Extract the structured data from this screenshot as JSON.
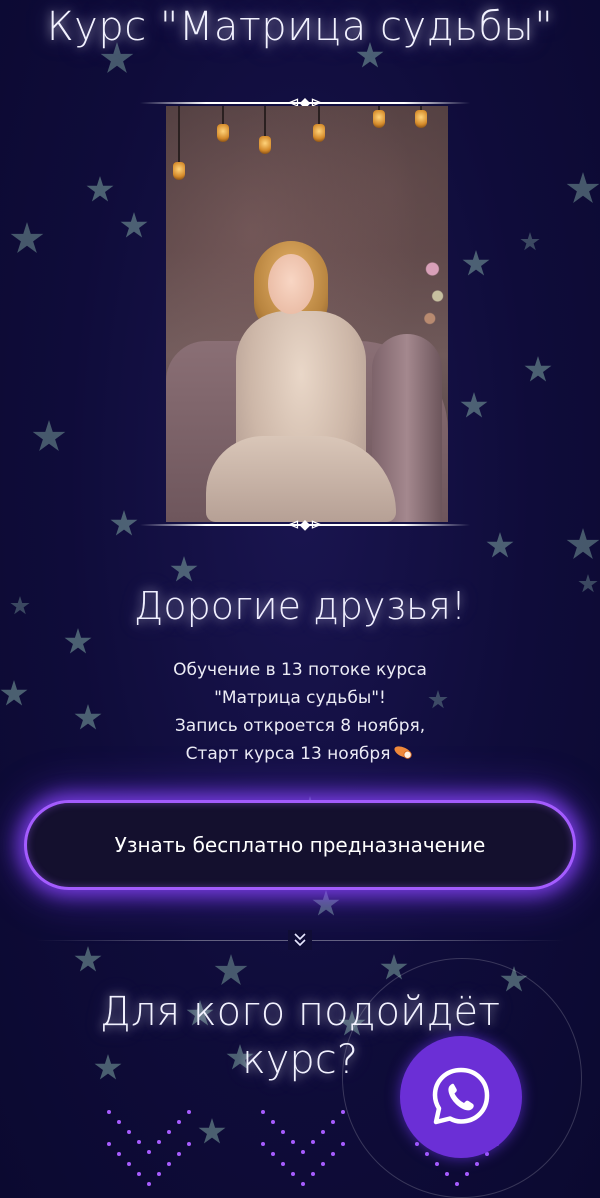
{
  "header": {
    "title": "Курс \"Матрица судьбы\""
  },
  "photo": {
    "alt": "Фото ведущей курса"
  },
  "intro": {
    "greeting": "Дорогие друзья!",
    "line1": "Обучение в 13 потоке курса",
    "line2": "\"Матрица судьбы\"!",
    "line3": "Запись откроется 8 ноября,",
    "line4": "Старт курса 13 ноября"
  },
  "cta": {
    "label": "Узнать бесплатно предназначение"
  },
  "section": {
    "title_line1": "Для кого подойдёт",
    "title_line2": "курс?"
  },
  "icons": {
    "divider": "chevrons-down-icon",
    "emoji": "comet-emoji-icon",
    "whatsapp": "whatsapp-icon"
  },
  "colors": {
    "background": "#0f0c3a",
    "accent": "#a45cff",
    "whatsapp_button": "#6b2fd6"
  }
}
